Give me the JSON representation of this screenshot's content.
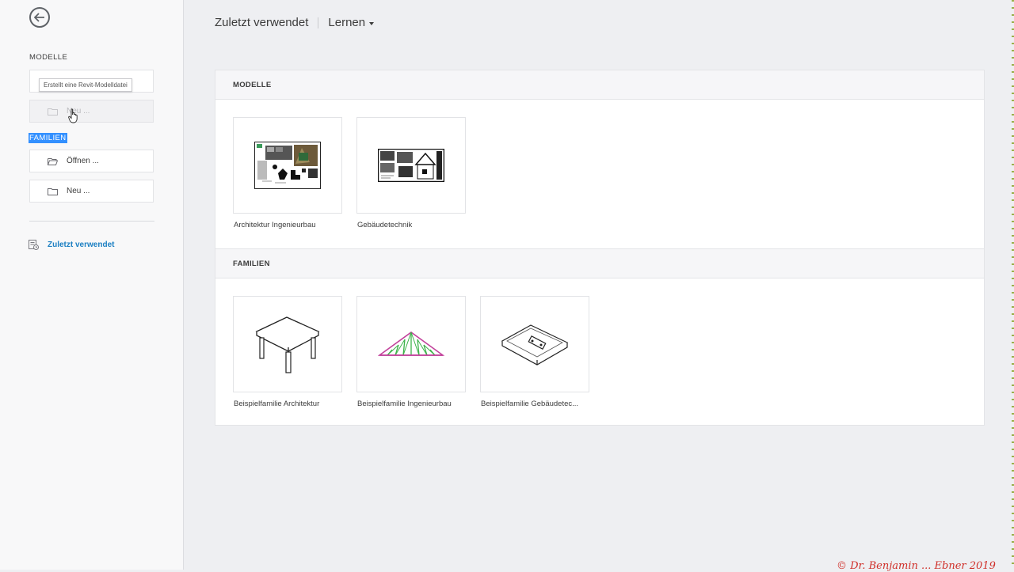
{
  "sidebar": {
    "models_heading": "MODELLE",
    "families_heading": "FAMILIEN",
    "tooltip": "Erstellt eine Revit-Modelldatei",
    "models_new_label": "Neu ...",
    "families_open_label": "Öffnen ...",
    "families_new_label": "Neu ...",
    "recent_link": "Zuletzt verwendet"
  },
  "header": {
    "title": "Zuletzt verwendet",
    "dropdown": "Lernen"
  },
  "main": {
    "models": {
      "heading": "MODELLE",
      "items": [
        {
          "label": "Architektur Ingenieurbau"
        },
        {
          "label": "Gebäudetechnik"
        }
      ]
    },
    "families": {
      "heading": "FAMILIEN",
      "items": [
        {
          "label": "Beispielfamilie Architektur"
        },
        {
          "label": "Beispielfamilie Ingenieurbau"
        },
        {
          "label": "Beispielfamilie Gebäudetec..."
        }
      ]
    }
  },
  "watermark": "© Dr. Benjamin ... Ebner 2019",
  "colors": {
    "accent": "#1d80c3",
    "selection": "#3390ff",
    "truss_pink": "#c2429b",
    "truss_green": "#3db34a"
  }
}
